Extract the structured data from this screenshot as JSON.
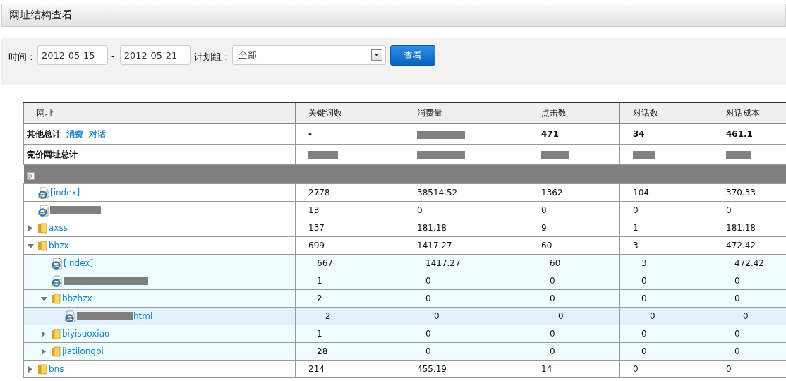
{
  "page_title": "网址结构查看",
  "filter": {
    "time_label": "时间：",
    "start_date": "2012-05-15",
    "separator": "-",
    "end_date": "2012-05-21",
    "group_label": "计划组：",
    "group_value": "全部",
    "submit": "查看"
  },
  "table": {
    "columns": [
      "网址",
      "关键词数",
      "消费量",
      "点击数",
      "对话数",
      "对话成本"
    ],
    "summary_rows": [
      {
        "kind": "summary",
        "label": "其他总计",
        "links": [
          "消费",
          "对话"
        ],
        "cells": [
          {
            "text": "-"
          },
          {
            "redacted": true
          },
          {
            "text": "471"
          },
          {
            "text": "34"
          },
          {
            "text": "461.1"
          }
        ]
      },
      {
        "kind": "summary",
        "label": "竞价网址总计",
        "cells": [
          {
            "redacted": true
          },
          {
            "redacted": true
          },
          {
            "redacted": true
          },
          {
            "redacted": true
          },
          {
            "redacted": true
          }
        ]
      },
      {
        "kind": "masked"
      }
    ],
    "tree": [
      {
        "kind": "page",
        "name": "[index]",
        "redacted": false,
        "selected": false,
        "values": [
          "2778",
          "38514.52",
          "1362",
          "104",
          "370.33"
        ]
      },
      {
        "kind": "page",
        "redacted": true,
        "selected": false,
        "values": [
          "13",
          "0",
          "0",
          "0",
          "0"
        ]
      },
      {
        "kind": "folder",
        "name": "axss",
        "expanded": false,
        "selected": false,
        "values": [
          "137",
          "181.18",
          "9",
          "1",
          "181.18"
        ]
      },
      {
        "kind": "folder",
        "name": "bbzx",
        "expanded": true,
        "selected": false,
        "values": [
          "699",
          "1417.27",
          "60",
          "3",
          "472.42"
        ],
        "children": [
          {
            "kind": "page",
            "name": "[index]",
            "redacted": false,
            "selected": false,
            "values": [
              "667",
              "1417.27",
              "60",
              "3",
              "472.42"
            ]
          },
          {
            "kind": "page",
            "redacted": true,
            "selected": false,
            "values": [
              "1",
              "0",
              "0",
              "0",
              "0"
            ]
          },
          {
            "kind": "folder",
            "name": "bbzhzx",
            "expanded": true,
            "selected": false,
            "values": [
              "2",
              "0",
              "0",
              "0",
              "0"
            ],
            "children": [
              {
                "kind": "page",
                "name": "html",
                "redacted": true,
                "selected": true,
                "values": [
                  "2",
                  "0",
                  "0",
                  "0",
                  "0"
                ]
              }
            ]
          },
          {
            "kind": "folder",
            "name": "biyisuoxiao",
            "expanded": false,
            "selected": false,
            "values": [
              "1",
              "0",
              "0",
              "0",
              "0"
            ]
          },
          {
            "kind": "folder",
            "name": "jiatilongbi",
            "expanded": false,
            "selected": false,
            "values": [
              "28",
              "0",
              "0",
              "0",
              "0"
            ]
          }
        ]
      },
      {
        "kind": "folder",
        "name": "bns",
        "expanded": false,
        "selected": false,
        "values": [
          "214",
          "455.19",
          "14",
          "0",
          "0"
        ]
      }
    ]
  }
}
